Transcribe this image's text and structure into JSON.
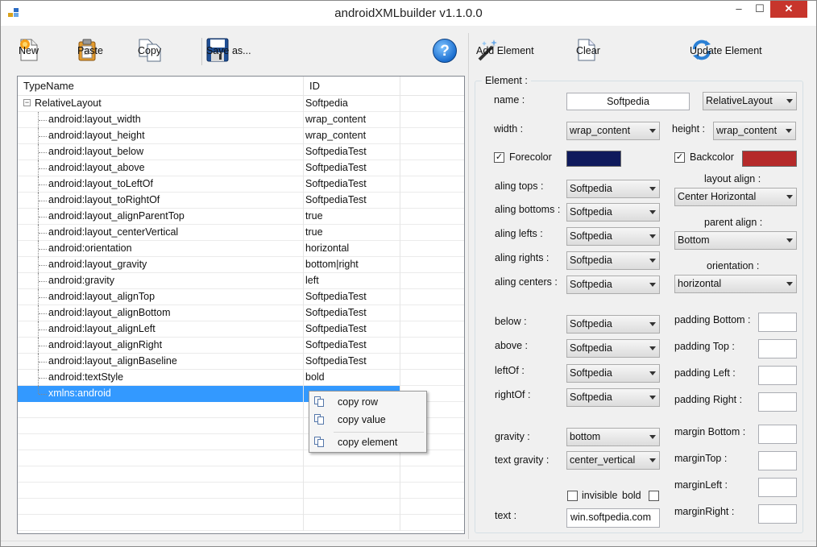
{
  "window": {
    "title": "androidXMLbuilder v1.1.0.0",
    "min_glyph": "–",
    "max_glyph": "☐",
    "close_glyph": "✕"
  },
  "left_toolbar": {
    "new_label": "New",
    "paste_label": "Paste",
    "copy_label": "Copy",
    "save_label": "Save as...",
    "help_glyph": "?"
  },
  "right_toolbar": {
    "add_label": "Add Element",
    "clear_label": "Clear",
    "update_label": "Update Element"
  },
  "tree": {
    "col_type": "TypeName",
    "col_id": "ID",
    "root": {
      "name": "RelativeLayout",
      "value": "Softpedia",
      "expander": "−"
    },
    "rows": [
      {
        "name": "android:layout_width",
        "value": "wrap_content"
      },
      {
        "name": "android:layout_height",
        "value": "wrap_content"
      },
      {
        "name": "android:layout_below",
        "value": "SoftpediaTest"
      },
      {
        "name": "android:layout_above",
        "value": "SoftpediaTest"
      },
      {
        "name": "android:layout_toLeftOf",
        "value": "SoftpediaTest"
      },
      {
        "name": "android:layout_toRightOf",
        "value": "SoftpediaTest"
      },
      {
        "name": "android:layout_alignParentTop",
        "value": "true"
      },
      {
        "name": "android:layout_centerVertical",
        "value": "true"
      },
      {
        "name": "android:orientation",
        "value": "horizontal"
      },
      {
        "name": "android:layout_gravity",
        "value": "bottom|right"
      },
      {
        "name": "android:gravity",
        "value": "left"
      },
      {
        "name": "android:layout_alignTop",
        "value": "SoftpediaTest"
      },
      {
        "name": "android:layout_alignBottom",
        "value": "SoftpediaTest"
      },
      {
        "name": "android:layout_alignLeft",
        "value": "SoftpediaTest"
      },
      {
        "name": "android:layout_alignRight",
        "value": "SoftpediaTest"
      },
      {
        "name": "android:layout_alignBaseline",
        "value": "SoftpediaTest"
      },
      {
        "name": "android:textStyle",
        "value": "bold"
      },
      {
        "name": "xmlns:android",
        "value": ""
      }
    ],
    "selected_index": 17
  },
  "context_menu": {
    "items": [
      "copy row",
      "copy value",
      "copy element"
    ]
  },
  "element": {
    "group_title": "Element :",
    "name_label": "name :",
    "name_value": "Softpedia",
    "type_value": "RelativeLayout",
    "width_label": "width :",
    "width_value": "wrap_content",
    "height_label": "height :",
    "height_value": "wrap_content",
    "forecolor_label": "Forecolor",
    "forecolor_checked": "✓",
    "forecolor_color": "#0f1a5c",
    "backcolor_label": "Backcolor",
    "backcolor_checked": "✓",
    "backcolor_color": "#b52a2a",
    "aling_tops_label": "aling tops :",
    "aling_tops_value": "Softpedia",
    "aling_bottoms_label": "aling bottoms :",
    "aling_bottoms_value": "Softpedia",
    "aling_lefts_label": "aling lefts :",
    "aling_lefts_value": "Softpedia",
    "aling_rights_label": "aling rights :",
    "aling_rights_value": "Softpedia",
    "aling_centers_label": "aling centers :",
    "aling_centers_value": "Softpedia",
    "layout_align_label": "layout align :",
    "layout_align_value": "Center Horizontal",
    "parent_align_label": "parent align :",
    "parent_align_value": "Bottom",
    "orientation_label": "orientation :",
    "orientation_value": "horizontal",
    "below_label": "below :",
    "below_value": "Softpedia",
    "above_label": "above :",
    "above_value": "Softpedia",
    "leftof_label": "leftOf :",
    "leftof_value": "Softpedia",
    "rightof_label": "rightOf :",
    "rightof_value": "Softpedia",
    "padding_bottom_label": "padding Bottom :",
    "padding_top_label": "padding Top :",
    "padding_left_label": "padding Left :",
    "padding_right_label": "padding Right :",
    "margin_bottom_label": "margin Bottom :",
    "margin_top_label": "marginTop :",
    "margin_left_label": "marginLeft :",
    "margin_right_label": "marginRight :",
    "gravity_label": "gravity :",
    "gravity_value": "bottom",
    "text_gravity_label": "text gravity :",
    "text_gravity_value": "center_vertical",
    "invisible_label": "invisible",
    "bold_label": "bold",
    "text_label": "text :",
    "text_value": "win.softpedia.com"
  }
}
